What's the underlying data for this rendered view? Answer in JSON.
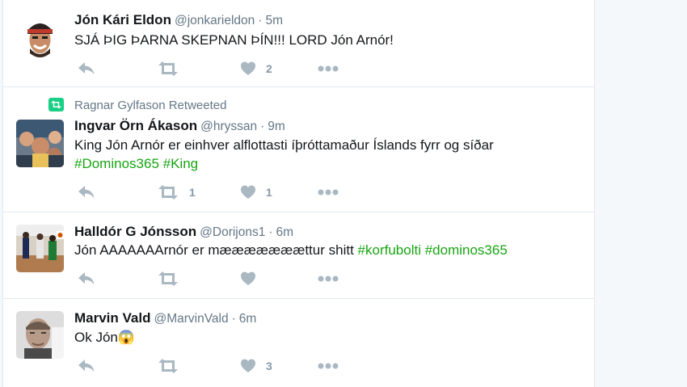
{
  "tweets": [
    {
      "name": "Jón Kári Eldon",
      "handle": "@jonkarieldon",
      "sep": "·",
      "time": "5m",
      "text": "SJÁ ÞIG ÞARNA SKEPNAN ÞÍN!!! LORD Jón Arnór!",
      "retweets": "",
      "likes": "2"
    },
    {
      "retweeted_by": "Ragnar Gylfason Retweeted",
      "name": "Ingvar Örn Ákason",
      "handle": "@hryssan",
      "sep": "·",
      "time": "9m",
      "text": "King Jón Arnór er einhver alflottasti íþróttamaður Íslands fyrr og síðar",
      "hashtags": [
        "#Dominos365",
        "#King"
      ],
      "retweets": "1",
      "likes": "1"
    },
    {
      "name": "Halldór G Jónsson",
      "handle": "@Dorijons1",
      "sep": "·",
      "time": "6m",
      "text": "Jón AAAAAAArnór er mææææææættur shitt",
      "hashtags": [
        "#korfubolti",
        "#dominos365"
      ],
      "retweets": "",
      "likes": ""
    },
    {
      "name": "Marvin Vald",
      "handle": "@MarvinVald",
      "sep": "·",
      "time": "6m",
      "text": "Ok Jón😱",
      "retweets": "",
      "likes": "3"
    }
  ],
  "icons": {
    "reply": "reply-icon",
    "retweet": "retweet-icon",
    "like": "heart-icon",
    "more": "more-icon"
  },
  "colors": {
    "hashtag": "#17a512",
    "retweet_badge": "#19cf86",
    "action_gray": "#aab8c2",
    "secondary_text": "#657786"
  }
}
